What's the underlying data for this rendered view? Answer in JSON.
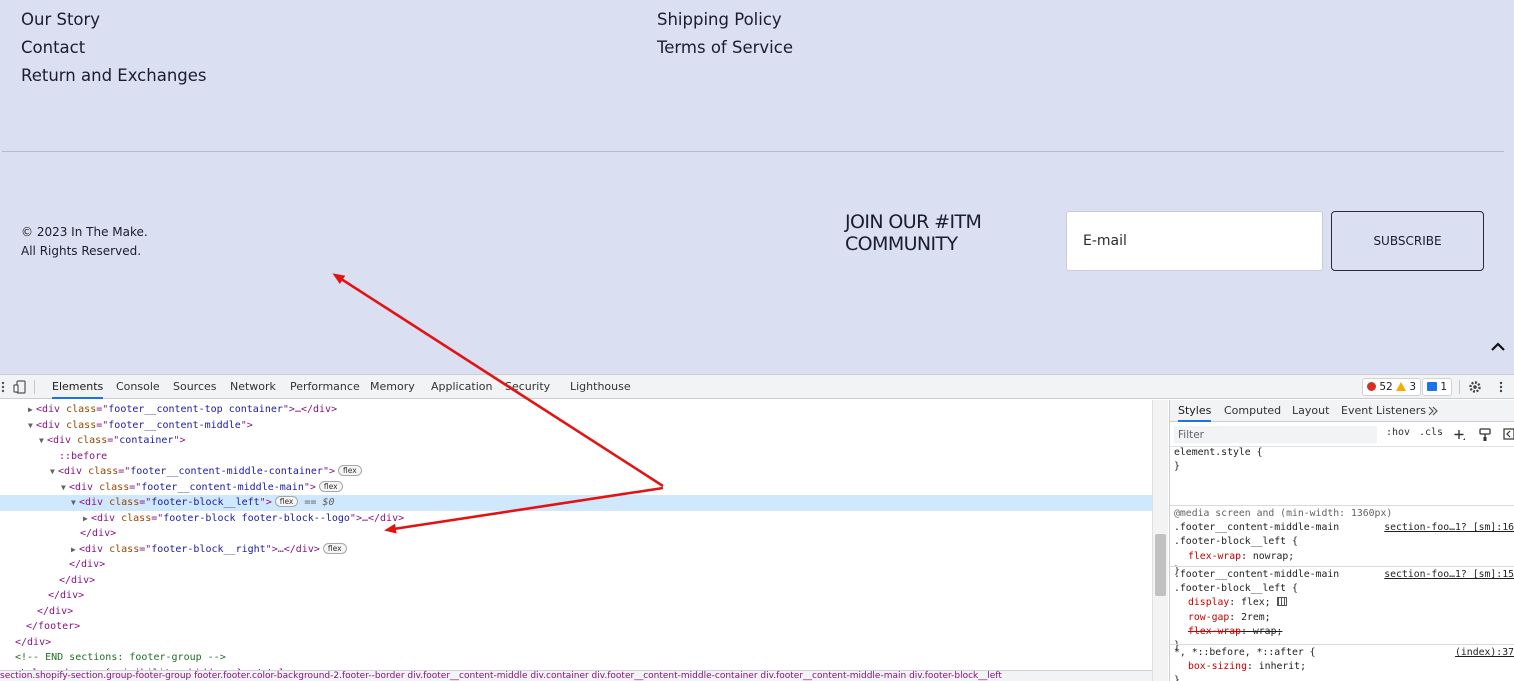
{
  "footer": {
    "links_left": [
      "Our Story",
      "Contact",
      "Return and Exchanges"
    ],
    "links_middle": [
      "Shipping Policy",
      "Terms of Service"
    ],
    "copyright_line1": "© 2023 In The Make.",
    "copyright_line2": "All Rights Reserved.",
    "join_title": "JOIN OUR #ITM COMMUNITY",
    "email_placeholder": "E-mail",
    "subscribe_label": "SUBSCRIBE"
  },
  "devtools": {
    "tabs": [
      "Elements",
      "Console",
      "Sources",
      "Network",
      "Performance",
      "Memory",
      "Application",
      "Security",
      "Lighthouse"
    ],
    "active_tab": "Elements",
    "error_count": "52",
    "warning_count": "3",
    "message_count": "1",
    "dom_lines": [
      {
        "t": "▶",
        "open": "div",
        "attrs": [
          [
            "class",
            "footer__content-top container"
          ]
        ],
        "tail": ">…</div>"
      },
      {
        "t": "▼",
        "open": "div",
        "attrs": [
          [
            "class",
            "footer__content-middle"
          ]
        ],
        "tail": ">"
      },
      {
        "t": "▼",
        "open": "div",
        "attrs": [
          [
            "class",
            "container"
          ]
        ],
        "tail": ">"
      },
      {
        "t": "",
        "pseudo": "::before"
      },
      {
        "t": "▼",
        "open": "div",
        "attrs": [
          [
            "class",
            "footer__content-middle-container"
          ]
        ],
        "tail": ">",
        "pill": "flex"
      },
      {
        "t": "▼",
        "open": "div",
        "attrs": [
          [
            "class",
            "footer__content-middle-main"
          ]
        ],
        "tail": ">",
        "pill": "flex"
      },
      {
        "t": "▼",
        "open": "div",
        "attrs": [
          [
            "class",
            "footer-block__left"
          ]
        ],
        "tail": ">",
        "pill": "flex",
        "eq": "== $0",
        "selected": true
      },
      {
        "t": "▶",
        "open": "div",
        "attrs": [
          [
            "class",
            "footer-block footer-block--logo"
          ]
        ],
        "tail": ">…</div>"
      },
      {
        "t": "",
        "close": "</div>"
      },
      {
        "t": "▶",
        "open": "div",
        "attrs": [
          [
            "class",
            "footer-block__right"
          ]
        ],
        "tail": ">…</div>",
        "pill": "flex"
      },
      {
        "t": "",
        "close": "</div>"
      },
      {
        "t": "",
        "close": "</div>"
      },
      {
        "t": "",
        "close": "</div>"
      },
      {
        "t": "",
        "close": "</div>"
      },
      {
        "t": "",
        "close": "</footer>"
      },
      {
        "t": "",
        "close": "</div>"
      },
      {
        "t": "",
        "comment": "<!-- END sections: footer-group -->"
      },
      {
        "t": "",
        "raw": "<style> .drawer { visibility: hidden; } </style>"
      }
    ],
    "breadcrumb": "section.shopify-section.group-footer-group   footer.footer.color-background-2.footer--border   div.footer__content-middle   div.container   div.footer__content-middle-container   div.footer__content-middle-main   div.footer-block__left",
    "styles_tabs": [
      "Styles",
      "Computed",
      "Layout",
      "Event Listeners"
    ],
    "filter_placeholder": "Filter",
    "hov_label": ":hov",
    "cls_label": ".cls",
    "rules": [
      {
        "lines": [
          "element.style {",
          "}"
        ]
      },
      {
        "lines": [
          "@media screen and (min-width: 1360px)",
          ".footer__content-middle-main",
          ".footer-block__left {",
          "  flex-wrap: nowrap;",
          "}"
        ],
        "source": "section-foo…1? [sm]:16"
      },
      {
        "lines": [
          ".footer__content-middle-main",
          ".footer-block__left {",
          "  display: flex;",
          "  row-gap: 2rem;",
          "  flex-wrap: wrap;",
          "}"
        ],
        "source": "section-foo…1? [sm]:15"
      },
      {
        "lines": [
          "*, *::before, *::after {",
          "  box-sizing: inherit;",
          "}"
        ],
        "source": "(index):37"
      }
    ]
  }
}
